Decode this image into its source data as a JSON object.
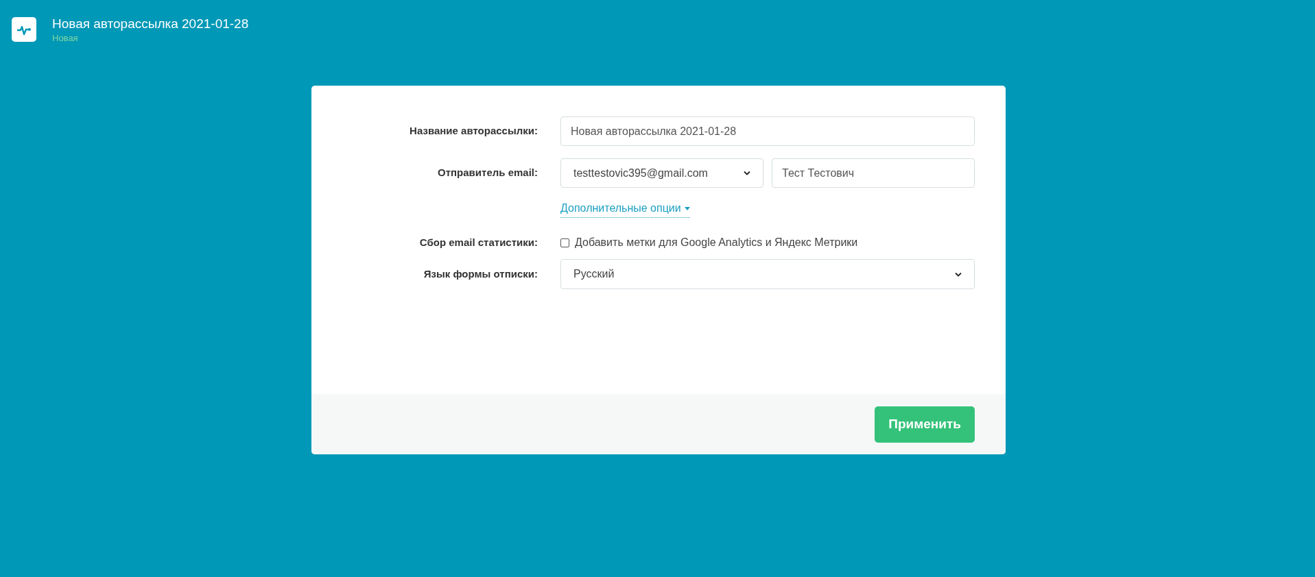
{
  "header": {
    "title": "Новая авторассылка 2021-01-28",
    "status": "Новая"
  },
  "form": {
    "name_row": {
      "label": "Название авторассылки:",
      "value": "Новая авторассылка 2021-01-28"
    },
    "sender_row": {
      "label": "Отправитель email:",
      "email": "testtestovic395@gmail.com",
      "sender_name": "Тест Тестович"
    },
    "more_options": {
      "label": "Дополнительные опции",
      "expanded": false
    },
    "stats_row": {
      "label": "Сбор email статистики:",
      "checkbox_label": "Добавить метки для Google Analytics и Яндекс Метрики",
      "checked": false
    },
    "language_row": {
      "label": "Язык формы отписки:",
      "value": "Русский"
    }
  },
  "footer": {
    "apply_button": "Применить"
  }
}
